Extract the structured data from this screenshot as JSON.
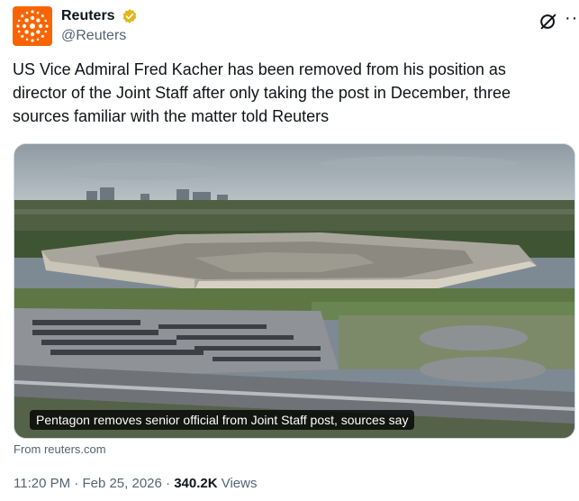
{
  "author": {
    "name": "Reuters",
    "handle": "@Reuters",
    "verified_color": "#e2b719",
    "avatar_color": "#fa6400"
  },
  "icons": {
    "verified": "verified-badge-icon",
    "grok": "grok-icon",
    "more": "more-icon"
  },
  "tweet": {
    "text": "US Vice Admiral Fred Kacher has been removed from his position as director of the Joint Staff after only taking the post in December, three sources familiar with the matter told Reuters"
  },
  "card": {
    "caption": "Pentagon removes senior official from Joint Staff post, sources say",
    "source": "From reuters.com"
  },
  "meta": {
    "time": "11:20 PM",
    "sep1": " · ",
    "date": "Feb 25, 2026",
    "sep2": " · ",
    "views_count": "340.2K",
    "views_label": " Views"
  }
}
